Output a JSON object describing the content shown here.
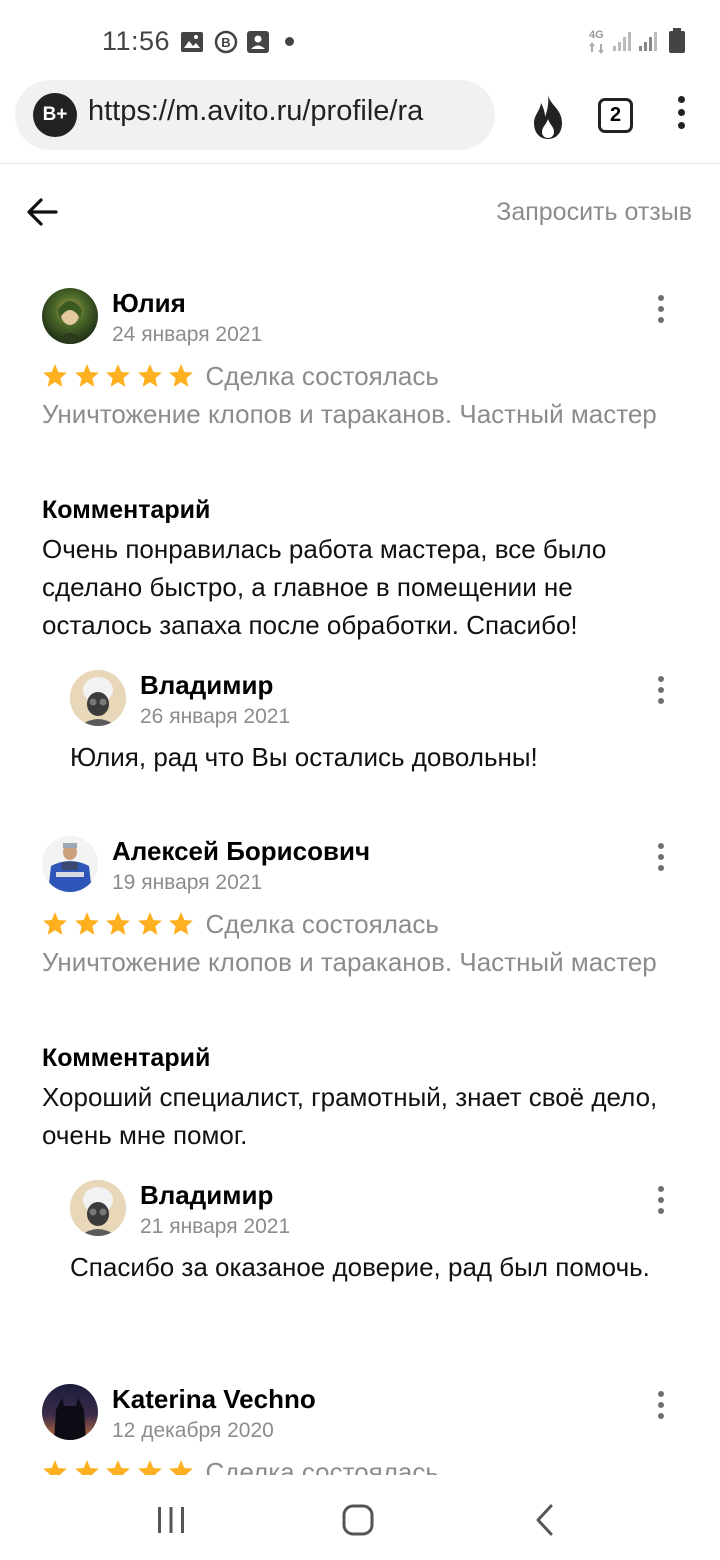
{
  "status_bar": {
    "time": "11:56",
    "network": "4G"
  },
  "browser": {
    "tab_icon_label": "B+",
    "url": "https://m.avito.ru/profile/ra",
    "tab_count": "2"
  },
  "header": {
    "request_review_label": "Запросить отзыв"
  },
  "reviews": [
    {
      "author": "Юлия",
      "date": "24 января 2021",
      "rating": 5,
      "deal_status": "Сделка состоялась",
      "service": "Уничтожение клопов и тараканов. Частный мастер",
      "comment_title": "Комментарий",
      "comment": "Очень понравилась работа мастера, все было сделано быстро, а главное в помещении не осталось запаха после обработки. Спасибо!",
      "reply": {
        "author": "Владимир",
        "date": "26 января 2021",
        "text": "Юлия, рад что Вы остались довольны!"
      }
    },
    {
      "author": "Алексей Борисович",
      "date": "19 января 2021",
      "rating": 5,
      "deal_status": "Сделка состоялась",
      "service": "Уничтожение клопов и тараканов. Частный мастер",
      "comment_title": "Комментарий",
      "comment": "Хороший специалист, грамотный, знает своё дело, очень мне помог.",
      "reply": {
        "author": "Владимир",
        "date": "21 января 2021",
        "text": "Спасибо за оказаное доверие, рад был помочь."
      }
    },
    {
      "author": "Katerina Vechno",
      "date": "12 декабря 2020",
      "rating": 5,
      "deal_status": "Сделка состоялась"
    }
  ],
  "colors": {
    "star": "#ffb021",
    "secondary_text": "#8c8c8c"
  },
  "icons": {
    "back": "arrow-left-icon",
    "fire": "fire-icon",
    "menu": "more-vertical-icon",
    "nav": [
      "recent-apps-icon",
      "home-icon",
      "back-icon"
    ]
  }
}
